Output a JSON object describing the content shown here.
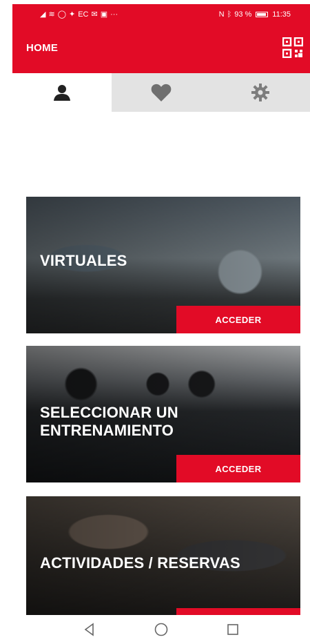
{
  "status_bar": {
    "left_text": "EC",
    "battery": "93 %",
    "time": "11:35"
  },
  "header": {
    "title": "HOME",
    "qr_icon": "qr-code-icon"
  },
  "tabs": [
    {
      "icon": "person-icon",
      "active": true
    },
    {
      "icon": "heart-icon",
      "active": false
    },
    {
      "icon": "gear-icon",
      "active": false
    }
  ],
  "cards": [
    {
      "title": "VIRTUALES",
      "action": "ACCEDER"
    },
    {
      "title": "SELECCIONAR UN ENTRENAMIENTO",
      "action": "ACCEDER"
    },
    {
      "title": "ACTIVIDADES / RESERVAS",
      "action": ""
    }
  ],
  "nav": [
    "back-icon",
    "home-icon",
    "recents-icon"
  ],
  "colors": {
    "accent": "#e20b26",
    "tab_inactive": "#e3e3e3"
  }
}
